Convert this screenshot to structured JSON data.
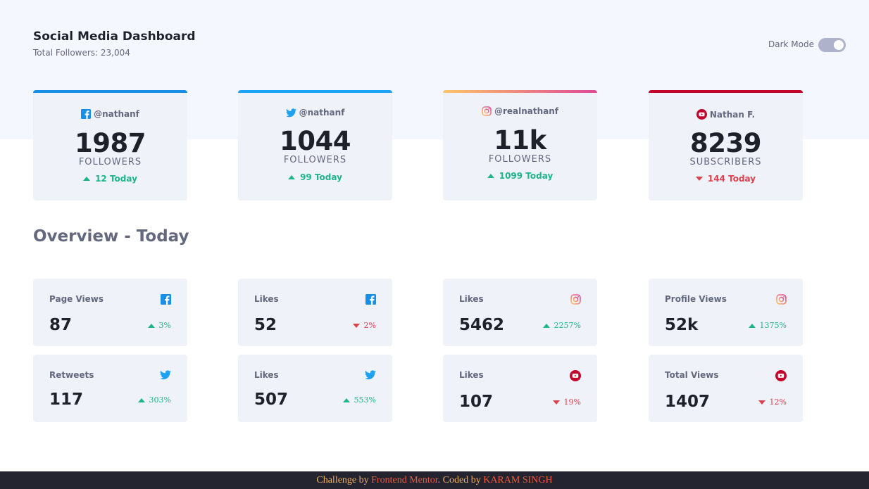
{
  "header": {
    "title": "Social Media Dashboard",
    "subtitle": "Total Followers: 23,004",
    "dark_mode_label": "Dark Mode"
  },
  "colors": {
    "facebook": "#178fe6",
    "twitter": "#1da1f2",
    "instagram_start": "#fdc468",
    "instagram_end": "#df4996",
    "youtube": "#c4032b",
    "up": "#1eb589",
    "down": "#dc414c"
  },
  "cards": [
    {
      "icon": "facebook-icon",
      "handle": "@nathanf",
      "count": "1987",
      "unit": "FOLLOWERS",
      "today": "12 Today",
      "trend": "up"
    },
    {
      "icon": "twitter-icon",
      "handle": "@nathanf",
      "count": "1044",
      "unit": "FOLLOWERS",
      "today": "99 Today",
      "trend": "up"
    },
    {
      "icon": "instagram-icon",
      "handle": "@realnathanf",
      "count": "11k",
      "unit": "FOLLOWERS",
      "today": "1099 Today",
      "trend": "up"
    },
    {
      "icon": "youtube-icon",
      "handle": "Nathan F.",
      "count": "8239",
      "unit": "SUBSCRIBERS",
      "today": "144 Today",
      "trend": "down"
    }
  ],
  "overview": {
    "title": "Overview - Today",
    "items": [
      {
        "label": "Page Views",
        "icon": "facebook-icon",
        "value": "87",
        "percent": "3%",
        "trend": "up"
      },
      {
        "label": "Likes",
        "icon": "facebook-icon",
        "value": "52",
        "percent": "2%",
        "trend": "down"
      },
      {
        "label": "Likes",
        "icon": "instagram-icon",
        "value": "5462",
        "percent": "2257%",
        "trend": "up"
      },
      {
        "label": "Profile Views",
        "icon": "instagram-icon",
        "value": "52k",
        "percent": "1375%",
        "trend": "up"
      },
      {
        "label": "Retweets",
        "icon": "twitter-icon",
        "value": "117",
        "percent": "303%",
        "trend": "up"
      },
      {
        "label": "Likes",
        "icon": "twitter-icon",
        "value": "507",
        "percent": "553%",
        "trend": "up"
      },
      {
        "label": "Likes",
        "icon": "youtube-icon",
        "value": "107",
        "percent": "19%",
        "trend": "down"
      },
      {
        "label": "Total Views",
        "icon": "youtube-icon",
        "value": "1407",
        "percent": "12%",
        "trend": "down"
      }
    ]
  },
  "footer": {
    "challenge_by": "Challenge by",
    "frontend_mentor": "Frontend Mentor",
    "coded_by": ". Coded by",
    "author": "KARAM SINGH"
  }
}
